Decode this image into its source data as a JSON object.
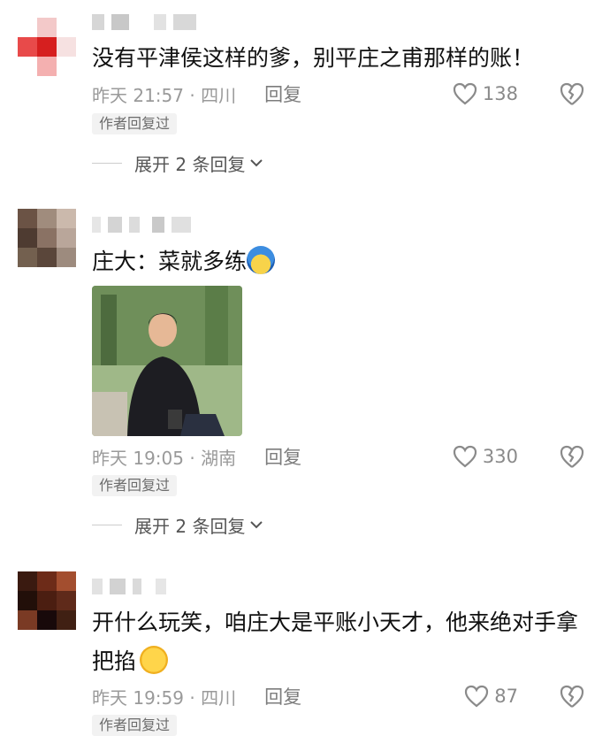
{
  "comments": [
    {
      "text": "没有平津侯这样的爹，别平庄之甫那样的账！",
      "time": "昨天 21:57 · 四川",
      "reply_label": "回复",
      "likes": "138",
      "author_tag": "作者回复过",
      "expand_label": "展开 2 条回复",
      "avatar_icon": "pixelated-avatar",
      "avatar_colors": [
        "#ffffff",
        "#f3c9c9",
        "#ffffff",
        "#e84a4a",
        "#d61f1f",
        "#f6e1e1",
        "#ffffff",
        "#f4b0b0",
        "#ffffff"
      ]
    },
    {
      "text": "庄大：菜就多练",
      "emoji_icon": "blue-hair-face-emoji-icon",
      "time": "昨天 19:05 · 湖南",
      "reply_label": "回复",
      "likes": "330",
      "author_tag": "作者回复过",
      "expand_label": "展开 2 条回复",
      "avatar_icon": "pixelated-avatar",
      "avatar_colors": [
        "#6b5345",
        "#a08c7d",
        "#cbb9ac",
        "#4e3b31",
        "#8a7264",
        "#b9a69a",
        "#73604f",
        "#5a463a",
        "#9d8b7e"
      ],
      "photo_icon": "man-in-black-jacket-photo"
    },
    {
      "text": "开什么玩笑，咱庄大是平账小天才，他来绝对手拿把掐",
      "emoji_icon": "thinking-face-emoji-icon",
      "time": "昨天 19:59 · 四川",
      "reply_label": "回复",
      "likes": "87",
      "author_tag": "作者回复过",
      "avatar_icon": "pixelated-avatar",
      "avatar_colors": [
        "#3a1a10",
        "#6d2b18",
        "#a34e2f",
        "#220f09",
        "#4b1e11",
        "#5f2a1a",
        "#7a3a24",
        "#18090a",
        "#402013"
      ]
    }
  ],
  "colors": {
    "text": "#111111",
    "meta": "#9a9a9a",
    "tag_bg": "#f2f2f2"
  }
}
